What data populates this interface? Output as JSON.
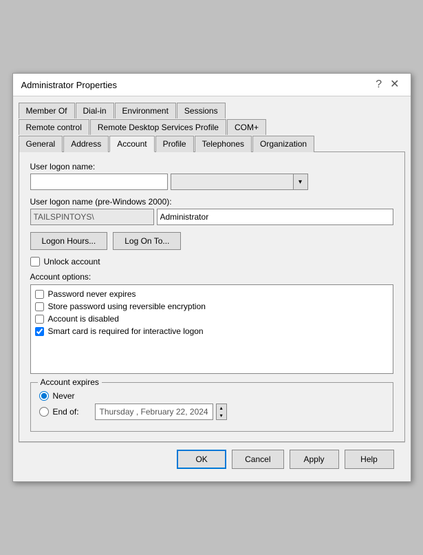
{
  "dialog": {
    "title": "Administrator Properties",
    "help_btn": "?",
    "close_btn": "✕"
  },
  "tabs": {
    "row1": [
      {
        "id": "member-of",
        "label": "Member Of"
      },
      {
        "id": "dial-in",
        "label": "Dial-in"
      },
      {
        "id": "environment",
        "label": "Environment"
      },
      {
        "id": "sessions",
        "label": "Sessions"
      }
    ],
    "row2": [
      {
        "id": "remote-control",
        "label": "Remote control"
      },
      {
        "id": "remote-desktop",
        "label": "Remote Desktop Services Profile"
      },
      {
        "id": "com",
        "label": "COM+"
      }
    ],
    "row3": [
      {
        "id": "general",
        "label": "General"
      },
      {
        "id": "address",
        "label": "Address"
      },
      {
        "id": "account",
        "label": "Account",
        "active": true
      },
      {
        "id": "profile",
        "label": "Profile"
      },
      {
        "id": "telephones",
        "label": "Telephones"
      },
      {
        "id": "organization",
        "label": "Organization"
      }
    ]
  },
  "account_tab": {
    "logon_name_label": "User logon name:",
    "logon_name_value": "",
    "logon_name_domain_placeholder": "",
    "logon_pre2000_label": "User logon name (pre-Windows 2000):",
    "logon_pre2000_domain": "TAILSPINTOYS\\",
    "logon_pre2000_name": "Administrator",
    "logon_hours_btn": "Logon Hours...",
    "logon_to_btn": "Log On To...",
    "unlock_label": "Unlock account",
    "account_options_label": "Account options:",
    "options": [
      {
        "id": "pwd-never-expires",
        "label": "Password never expires",
        "checked": false
      },
      {
        "id": "store-pwd-reversible",
        "label": "Store password using reversible encryption",
        "checked": false
      },
      {
        "id": "account-disabled",
        "label": "Account is disabled",
        "checked": false
      },
      {
        "id": "smart-card-required",
        "label": "Smart card is required for interactive logon",
        "checked": true
      }
    ],
    "account_expires_legend": "Account expires",
    "never_label": "Never",
    "end_of_label": "End of:",
    "date_value": "Thursday ,   February  22, 2024"
  },
  "footer": {
    "ok_label": "OK",
    "cancel_label": "Cancel",
    "apply_label": "Apply",
    "help_label": "Help"
  }
}
